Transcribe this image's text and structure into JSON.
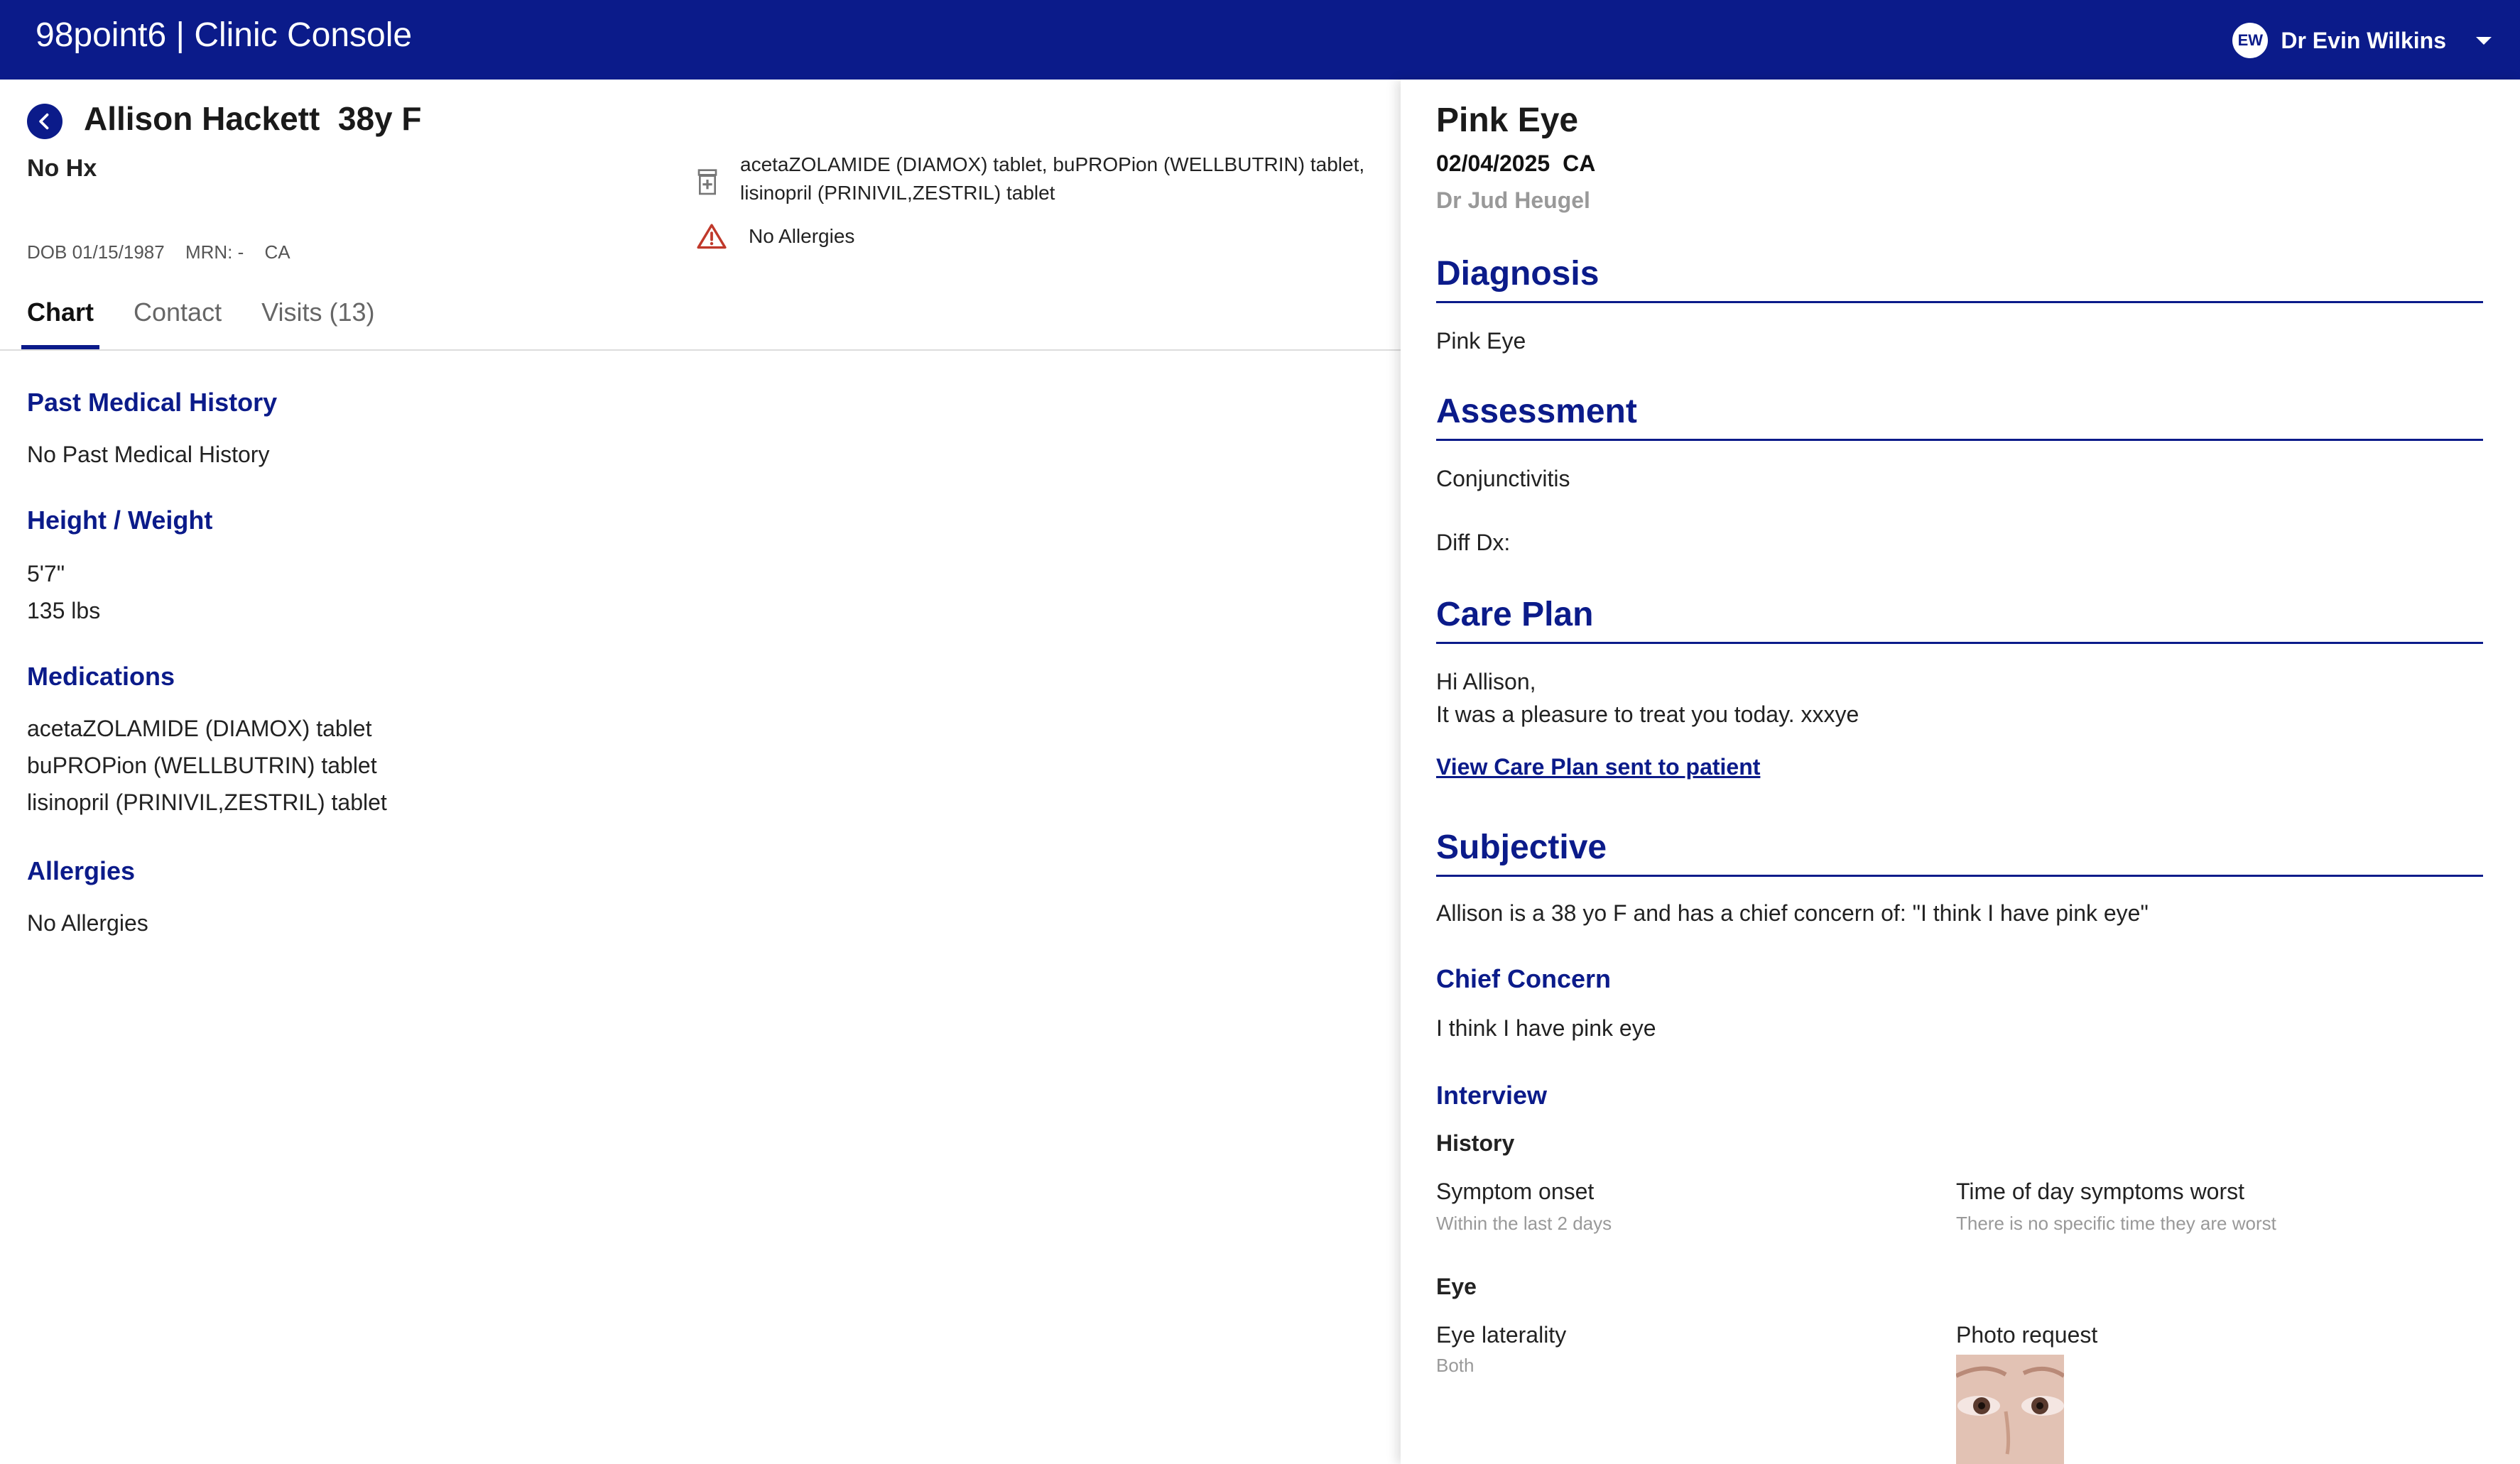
{
  "header": {
    "brand": "98point6 | Clinic Console",
    "user_initials": "EW",
    "user_name": "Dr Evin Wilkins"
  },
  "patient": {
    "name": "Allison Hackett  38y F",
    "history": "No Hx",
    "dob": "DOB 01/15/1987",
    "mrn": "MRN: -",
    "state": "CA",
    "medications_summary": "acetaZOLAMIDE (DIAMOX) tablet, buPROPion (WELLBUTRIN) tablet, lisinopril (PRINIVIL,ZESTRIL) tablet",
    "allergies_summary": "No Allergies"
  },
  "tabs": [
    {
      "label": "Chart",
      "active": true
    },
    {
      "label": "Contact",
      "active": false
    },
    {
      "label": "Visits (13)",
      "active": false
    }
  ],
  "chart": {
    "pmh_heading": "Past Medical History",
    "pmh_value": "No Past Medical History",
    "hw_heading": "Height / Weight",
    "height": "5'7\"",
    "weight": "135 lbs",
    "meds_heading": "Medications",
    "meds": [
      "acetaZOLAMIDE (DIAMOX) tablet",
      "buPROPion (WELLBUTRIN) tablet",
      "lisinopril (PRINIVIL,ZESTRIL) tablet"
    ],
    "allergies_heading": "Allergies",
    "allergies_value": "No Allergies"
  },
  "visit": {
    "title": "Pink Eye",
    "date": "02/04/2025",
    "state": "CA",
    "doctor": "Dr Jud Heugel",
    "diagnosis_heading": "Diagnosis",
    "diagnosis": "Pink Eye",
    "assessment_heading": "Assessment",
    "assessment": "Conjunctivitis",
    "diff_dx": "Diff Dx:",
    "care_plan_heading": "Care Plan",
    "care_plan_greeting": "Hi Allison,",
    "care_plan_body": "It was a pleasure to treat you today. xxxye",
    "care_plan_link": "View Care Plan sent to patient",
    "subjective_heading": "Subjective",
    "subjective": "Allison is a 38 yo F and has a chief concern of: \"I think I have pink eye\"",
    "chief_concern_heading": "Chief Concern",
    "chief_concern": "I think I have pink eye",
    "interview_heading": "Interview",
    "history_heading": "History",
    "symptom_onset_label": "Symptom onset",
    "symptom_onset_value": "Within the last 2 days",
    "time_of_day_label": "Time of day symptoms worst",
    "time_of_day_value": "There is no specific time they are worst",
    "eye_heading": "Eye",
    "eye_laterality_label": "Eye laterality",
    "eye_laterality_value": "Both",
    "photo_request_label": "Photo request"
  },
  "colors": {
    "brand_navy": "#0b1b8a",
    "alert_red": "#c0392b"
  },
  "icons": [
    "chevron-left-icon",
    "medication-icon",
    "warning-icon",
    "caret-down-icon"
  ]
}
